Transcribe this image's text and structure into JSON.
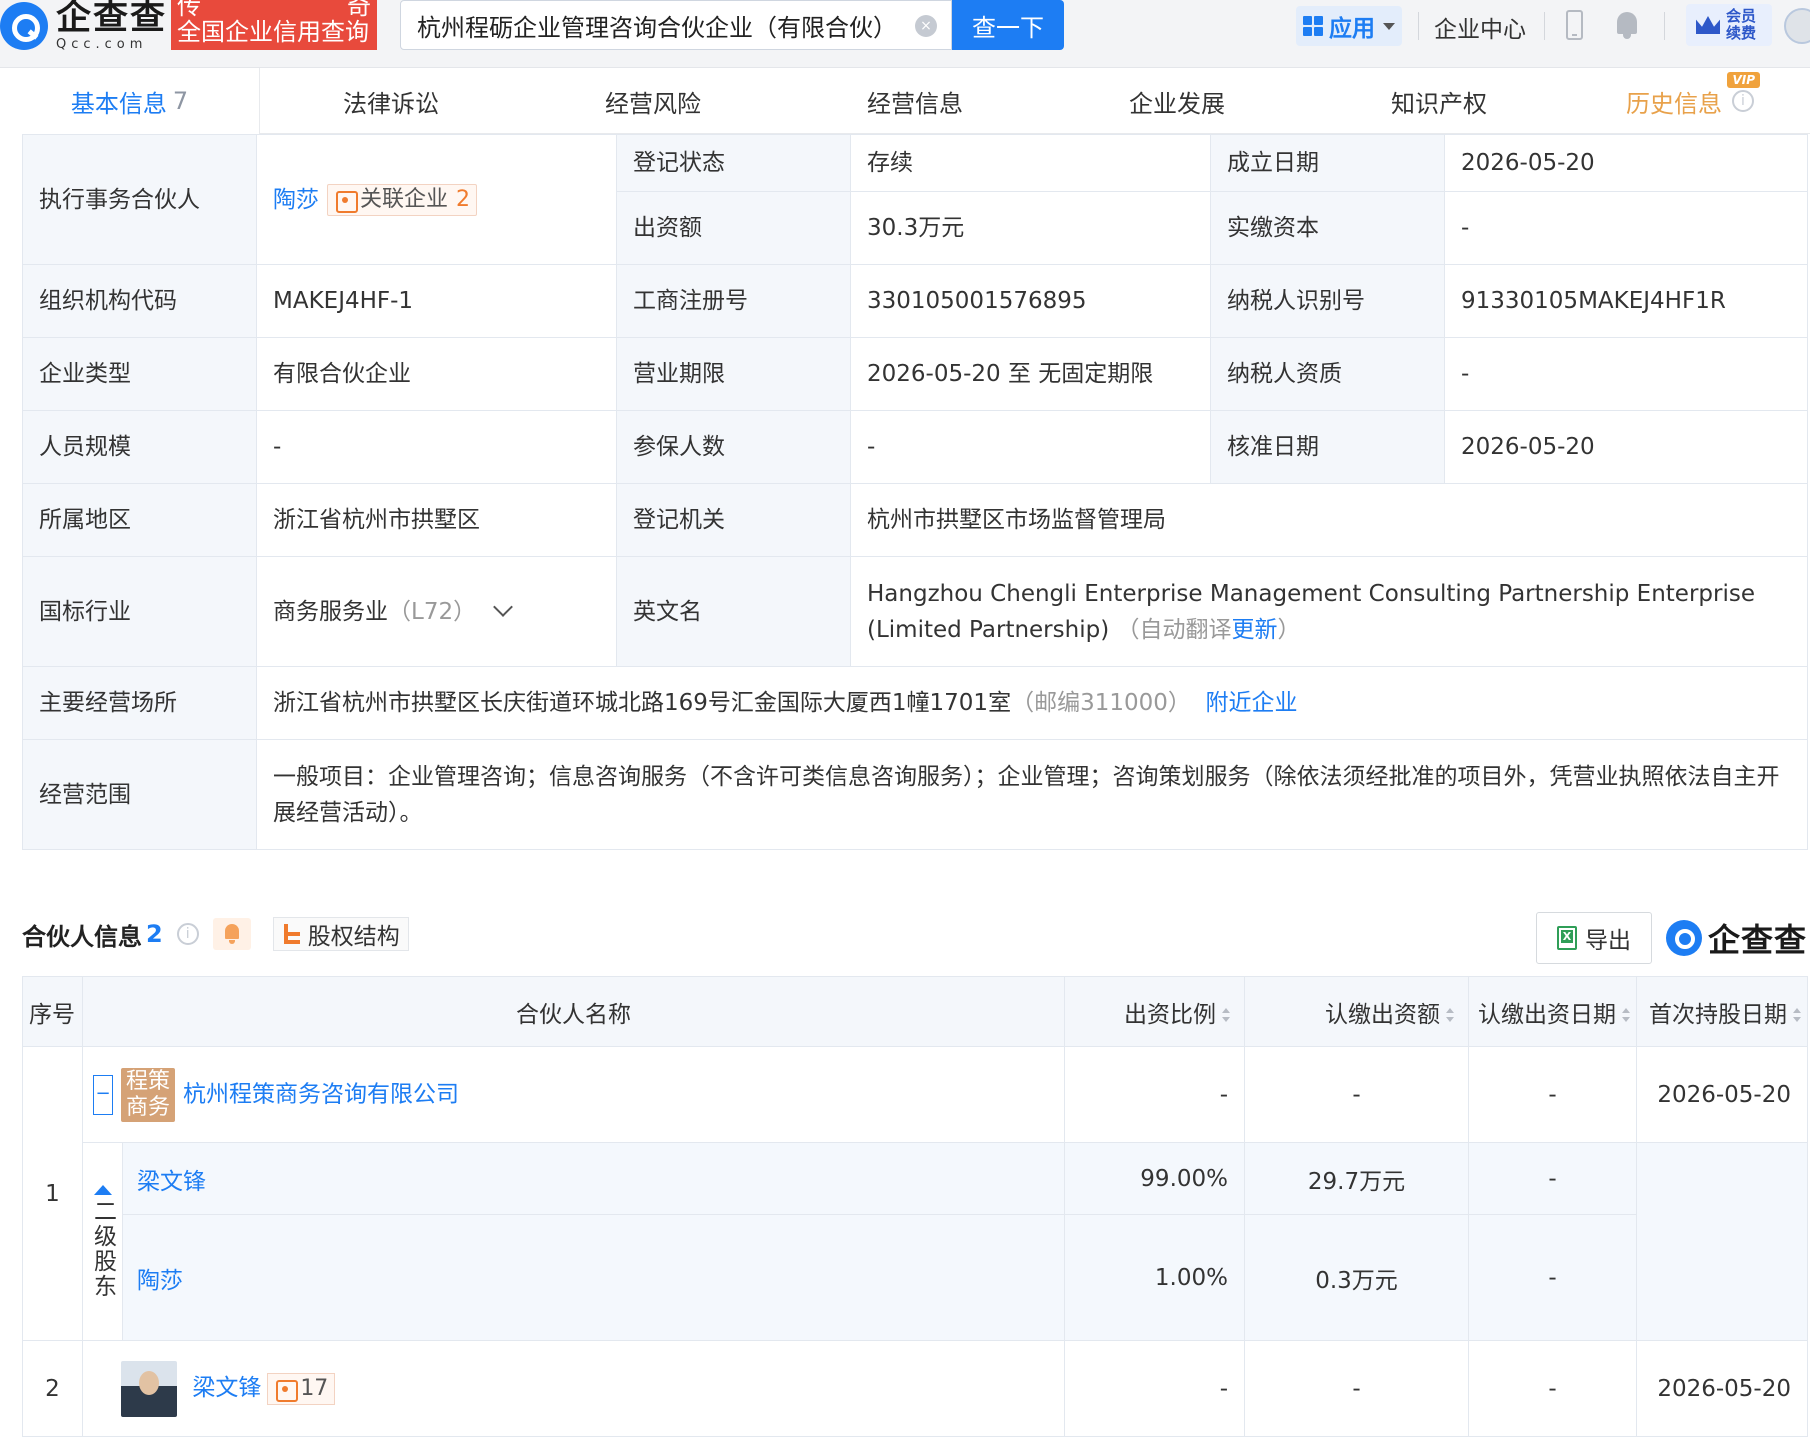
{
  "topbar": {
    "logo_cn": "企查查",
    "logo_en": "Qcc.com",
    "slogan_l1a": "传",
    "slogan_l1b": "奇",
    "slogan_l2": "全国企业信用查询",
    "search_value": "杭州程砺企业管理咨询合伙企业（有限合伙）",
    "search_button": "查一下",
    "apps_label": "应用",
    "enterprise_center": "企业中心",
    "vip_line1": "会员",
    "vip_line2": "续费"
  },
  "tabs": [
    {
      "label": "基本信息",
      "count": "7"
    },
    {
      "label": "法律诉讼"
    },
    {
      "label": "经营风险"
    },
    {
      "label": "经营信息"
    },
    {
      "label": "企业发展"
    },
    {
      "label": "知识产权"
    },
    {
      "label": "历史信息",
      "badge": "VIP"
    }
  ],
  "basic": {
    "partner_label": "执行事务合伙人",
    "partner_name": "陶莎",
    "related_label": "关联企业",
    "related_count": "2",
    "status_label": "登记状态",
    "status_value": "存续",
    "found_label": "成立日期",
    "found_value": "2026-05-20",
    "capital_label": "出资额",
    "capital_value": "30.3万元",
    "paid_label": "实缴资本",
    "paid_value": "-",
    "org_label": "组织机构代码",
    "org_value": "MAKEJ4HF-1",
    "reg_label": "工商注册号",
    "reg_value": "330105001576895",
    "tax_label": "纳税人识别号",
    "tax_value": "91330105MAKEJ4HF1R",
    "type_label": "企业类型",
    "type_value": "有限合伙企业",
    "term_label": "营业期限",
    "term_value": "2026-05-20 至 无固定期限",
    "taxq_label": "纳税人资质",
    "taxq_value": "-",
    "staff_label": "人员规模",
    "staff_value": "-",
    "insured_label": "参保人数",
    "insured_value": "-",
    "approve_label": "核准日期",
    "approve_value": "2026-05-20",
    "region_label": "所属地区",
    "region_value": "浙江省杭州市拱墅区",
    "authority_label": "登记机关",
    "authority_value": "杭州市拱墅区市场监督管理局",
    "industry_label": "国标行业",
    "industry_value": "商务服务业",
    "industry_code": "（L72）",
    "en_label": "英文名",
    "en_value": "Hangzhou Chengli Enterprise Management Consulting Partnership Enterprise (Limited Partnership)",
    "en_note": "（自动翻译",
    "en_update": "更新",
    "en_note_end": "）",
    "address_label": "主要经营场所",
    "address_value": "浙江省杭州市拱墅区长庆街道环城北路169号汇金国际大厦西1幢1701室",
    "postcode": "（邮编311000）",
    "nearby": "附近企业",
    "scope_label": "经营范围",
    "scope_value": "一般项目：企业管理咨询；信息咨询服务（不含许可类信息咨询服务）；企业管理；咨询策划服务（除依法须经批准的项目外，凭营业执照依法自主开展经营活动）。"
  },
  "partners": {
    "title": "合伙人信息",
    "count": "2",
    "equity_label": "股权结构",
    "export_label": "导出",
    "brand": "企查查",
    "headers": [
      "序号",
      "合伙人名称",
      "出资比例",
      "认缴出资额",
      "认缴出资日期",
      "首次持股日期"
    ],
    "rows": [
      {
        "index": "1",
        "collapse": "−",
        "logo_text": "程策商务",
        "name": "杭州程策商务咨询有限公司",
        "ratio": "-",
        "amount": "-",
        "sub_date": "-",
        "first_date": "2026-05-20",
        "level_label": "二级股东",
        "children": [
          {
            "name": "梁文锋",
            "ratio": "99.00%",
            "amount": "29.7万元",
            "sub_date": "-"
          },
          {
            "name": "陶莎",
            "ratio": "1.00%",
            "amount": "0.3万元",
            "sub_date": "-"
          }
        ]
      },
      {
        "index": "2",
        "name": "梁文锋",
        "related_count": "17",
        "ratio": "-",
        "amount": "-",
        "sub_date": "-",
        "first_date": "2026-05-20"
      }
    ]
  }
}
